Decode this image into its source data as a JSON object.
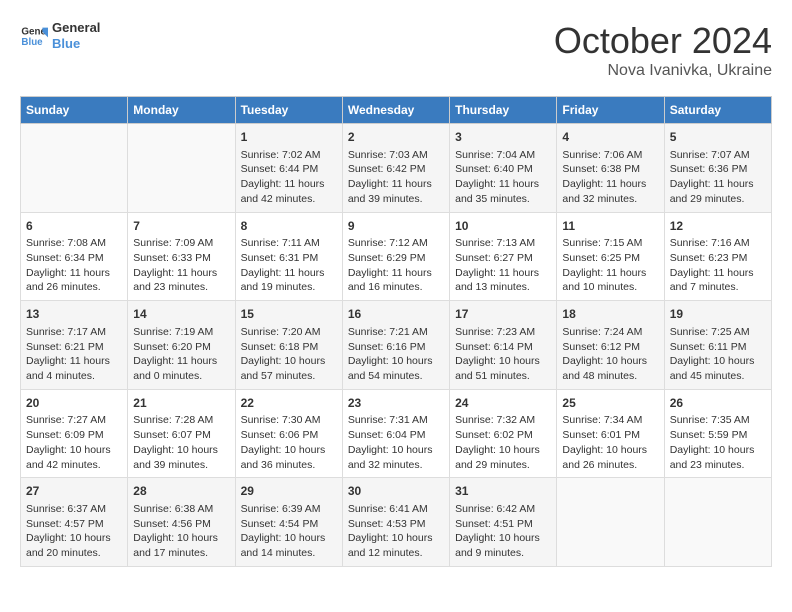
{
  "header": {
    "logo_line1": "General",
    "logo_line2": "Blue",
    "month": "October 2024",
    "location": "Nova Ivanivka, Ukraine"
  },
  "days_of_week": [
    "Sunday",
    "Monday",
    "Tuesday",
    "Wednesday",
    "Thursday",
    "Friday",
    "Saturday"
  ],
  "weeks": [
    [
      {
        "day": "",
        "info": ""
      },
      {
        "day": "",
        "info": ""
      },
      {
        "day": "1",
        "info": "Sunrise: 7:02 AM\nSunset: 6:44 PM\nDaylight: 11 hours and 42 minutes."
      },
      {
        "day": "2",
        "info": "Sunrise: 7:03 AM\nSunset: 6:42 PM\nDaylight: 11 hours and 39 minutes."
      },
      {
        "day": "3",
        "info": "Sunrise: 7:04 AM\nSunset: 6:40 PM\nDaylight: 11 hours and 35 minutes."
      },
      {
        "day": "4",
        "info": "Sunrise: 7:06 AM\nSunset: 6:38 PM\nDaylight: 11 hours and 32 minutes."
      },
      {
        "day": "5",
        "info": "Sunrise: 7:07 AM\nSunset: 6:36 PM\nDaylight: 11 hours and 29 minutes."
      }
    ],
    [
      {
        "day": "6",
        "info": "Sunrise: 7:08 AM\nSunset: 6:34 PM\nDaylight: 11 hours and 26 minutes."
      },
      {
        "day": "7",
        "info": "Sunrise: 7:09 AM\nSunset: 6:33 PM\nDaylight: 11 hours and 23 minutes."
      },
      {
        "day": "8",
        "info": "Sunrise: 7:11 AM\nSunset: 6:31 PM\nDaylight: 11 hours and 19 minutes."
      },
      {
        "day": "9",
        "info": "Sunrise: 7:12 AM\nSunset: 6:29 PM\nDaylight: 11 hours and 16 minutes."
      },
      {
        "day": "10",
        "info": "Sunrise: 7:13 AM\nSunset: 6:27 PM\nDaylight: 11 hours and 13 minutes."
      },
      {
        "day": "11",
        "info": "Sunrise: 7:15 AM\nSunset: 6:25 PM\nDaylight: 11 hours and 10 minutes."
      },
      {
        "day": "12",
        "info": "Sunrise: 7:16 AM\nSunset: 6:23 PM\nDaylight: 11 hours and 7 minutes."
      }
    ],
    [
      {
        "day": "13",
        "info": "Sunrise: 7:17 AM\nSunset: 6:21 PM\nDaylight: 11 hours and 4 minutes."
      },
      {
        "day": "14",
        "info": "Sunrise: 7:19 AM\nSunset: 6:20 PM\nDaylight: 11 hours and 0 minutes."
      },
      {
        "day": "15",
        "info": "Sunrise: 7:20 AM\nSunset: 6:18 PM\nDaylight: 10 hours and 57 minutes."
      },
      {
        "day": "16",
        "info": "Sunrise: 7:21 AM\nSunset: 6:16 PM\nDaylight: 10 hours and 54 minutes."
      },
      {
        "day": "17",
        "info": "Sunrise: 7:23 AM\nSunset: 6:14 PM\nDaylight: 10 hours and 51 minutes."
      },
      {
        "day": "18",
        "info": "Sunrise: 7:24 AM\nSunset: 6:12 PM\nDaylight: 10 hours and 48 minutes."
      },
      {
        "day": "19",
        "info": "Sunrise: 7:25 AM\nSunset: 6:11 PM\nDaylight: 10 hours and 45 minutes."
      }
    ],
    [
      {
        "day": "20",
        "info": "Sunrise: 7:27 AM\nSunset: 6:09 PM\nDaylight: 10 hours and 42 minutes."
      },
      {
        "day": "21",
        "info": "Sunrise: 7:28 AM\nSunset: 6:07 PM\nDaylight: 10 hours and 39 minutes."
      },
      {
        "day": "22",
        "info": "Sunrise: 7:30 AM\nSunset: 6:06 PM\nDaylight: 10 hours and 36 minutes."
      },
      {
        "day": "23",
        "info": "Sunrise: 7:31 AM\nSunset: 6:04 PM\nDaylight: 10 hours and 32 minutes."
      },
      {
        "day": "24",
        "info": "Sunrise: 7:32 AM\nSunset: 6:02 PM\nDaylight: 10 hours and 29 minutes."
      },
      {
        "day": "25",
        "info": "Sunrise: 7:34 AM\nSunset: 6:01 PM\nDaylight: 10 hours and 26 minutes."
      },
      {
        "day": "26",
        "info": "Sunrise: 7:35 AM\nSunset: 5:59 PM\nDaylight: 10 hours and 23 minutes."
      }
    ],
    [
      {
        "day": "27",
        "info": "Sunrise: 6:37 AM\nSunset: 4:57 PM\nDaylight: 10 hours and 20 minutes."
      },
      {
        "day": "28",
        "info": "Sunrise: 6:38 AM\nSunset: 4:56 PM\nDaylight: 10 hours and 17 minutes."
      },
      {
        "day": "29",
        "info": "Sunrise: 6:39 AM\nSunset: 4:54 PM\nDaylight: 10 hours and 14 minutes."
      },
      {
        "day": "30",
        "info": "Sunrise: 6:41 AM\nSunset: 4:53 PM\nDaylight: 10 hours and 12 minutes."
      },
      {
        "day": "31",
        "info": "Sunrise: 6:42 AM\nSunset: 4:51 PM\nDaylight: 10 hours and 9 minutes."
      },
      {
        "day": "",
        "info": ""
      },
      {
        "day": "",
        "info": ""
      }
    ]
  ]
}
